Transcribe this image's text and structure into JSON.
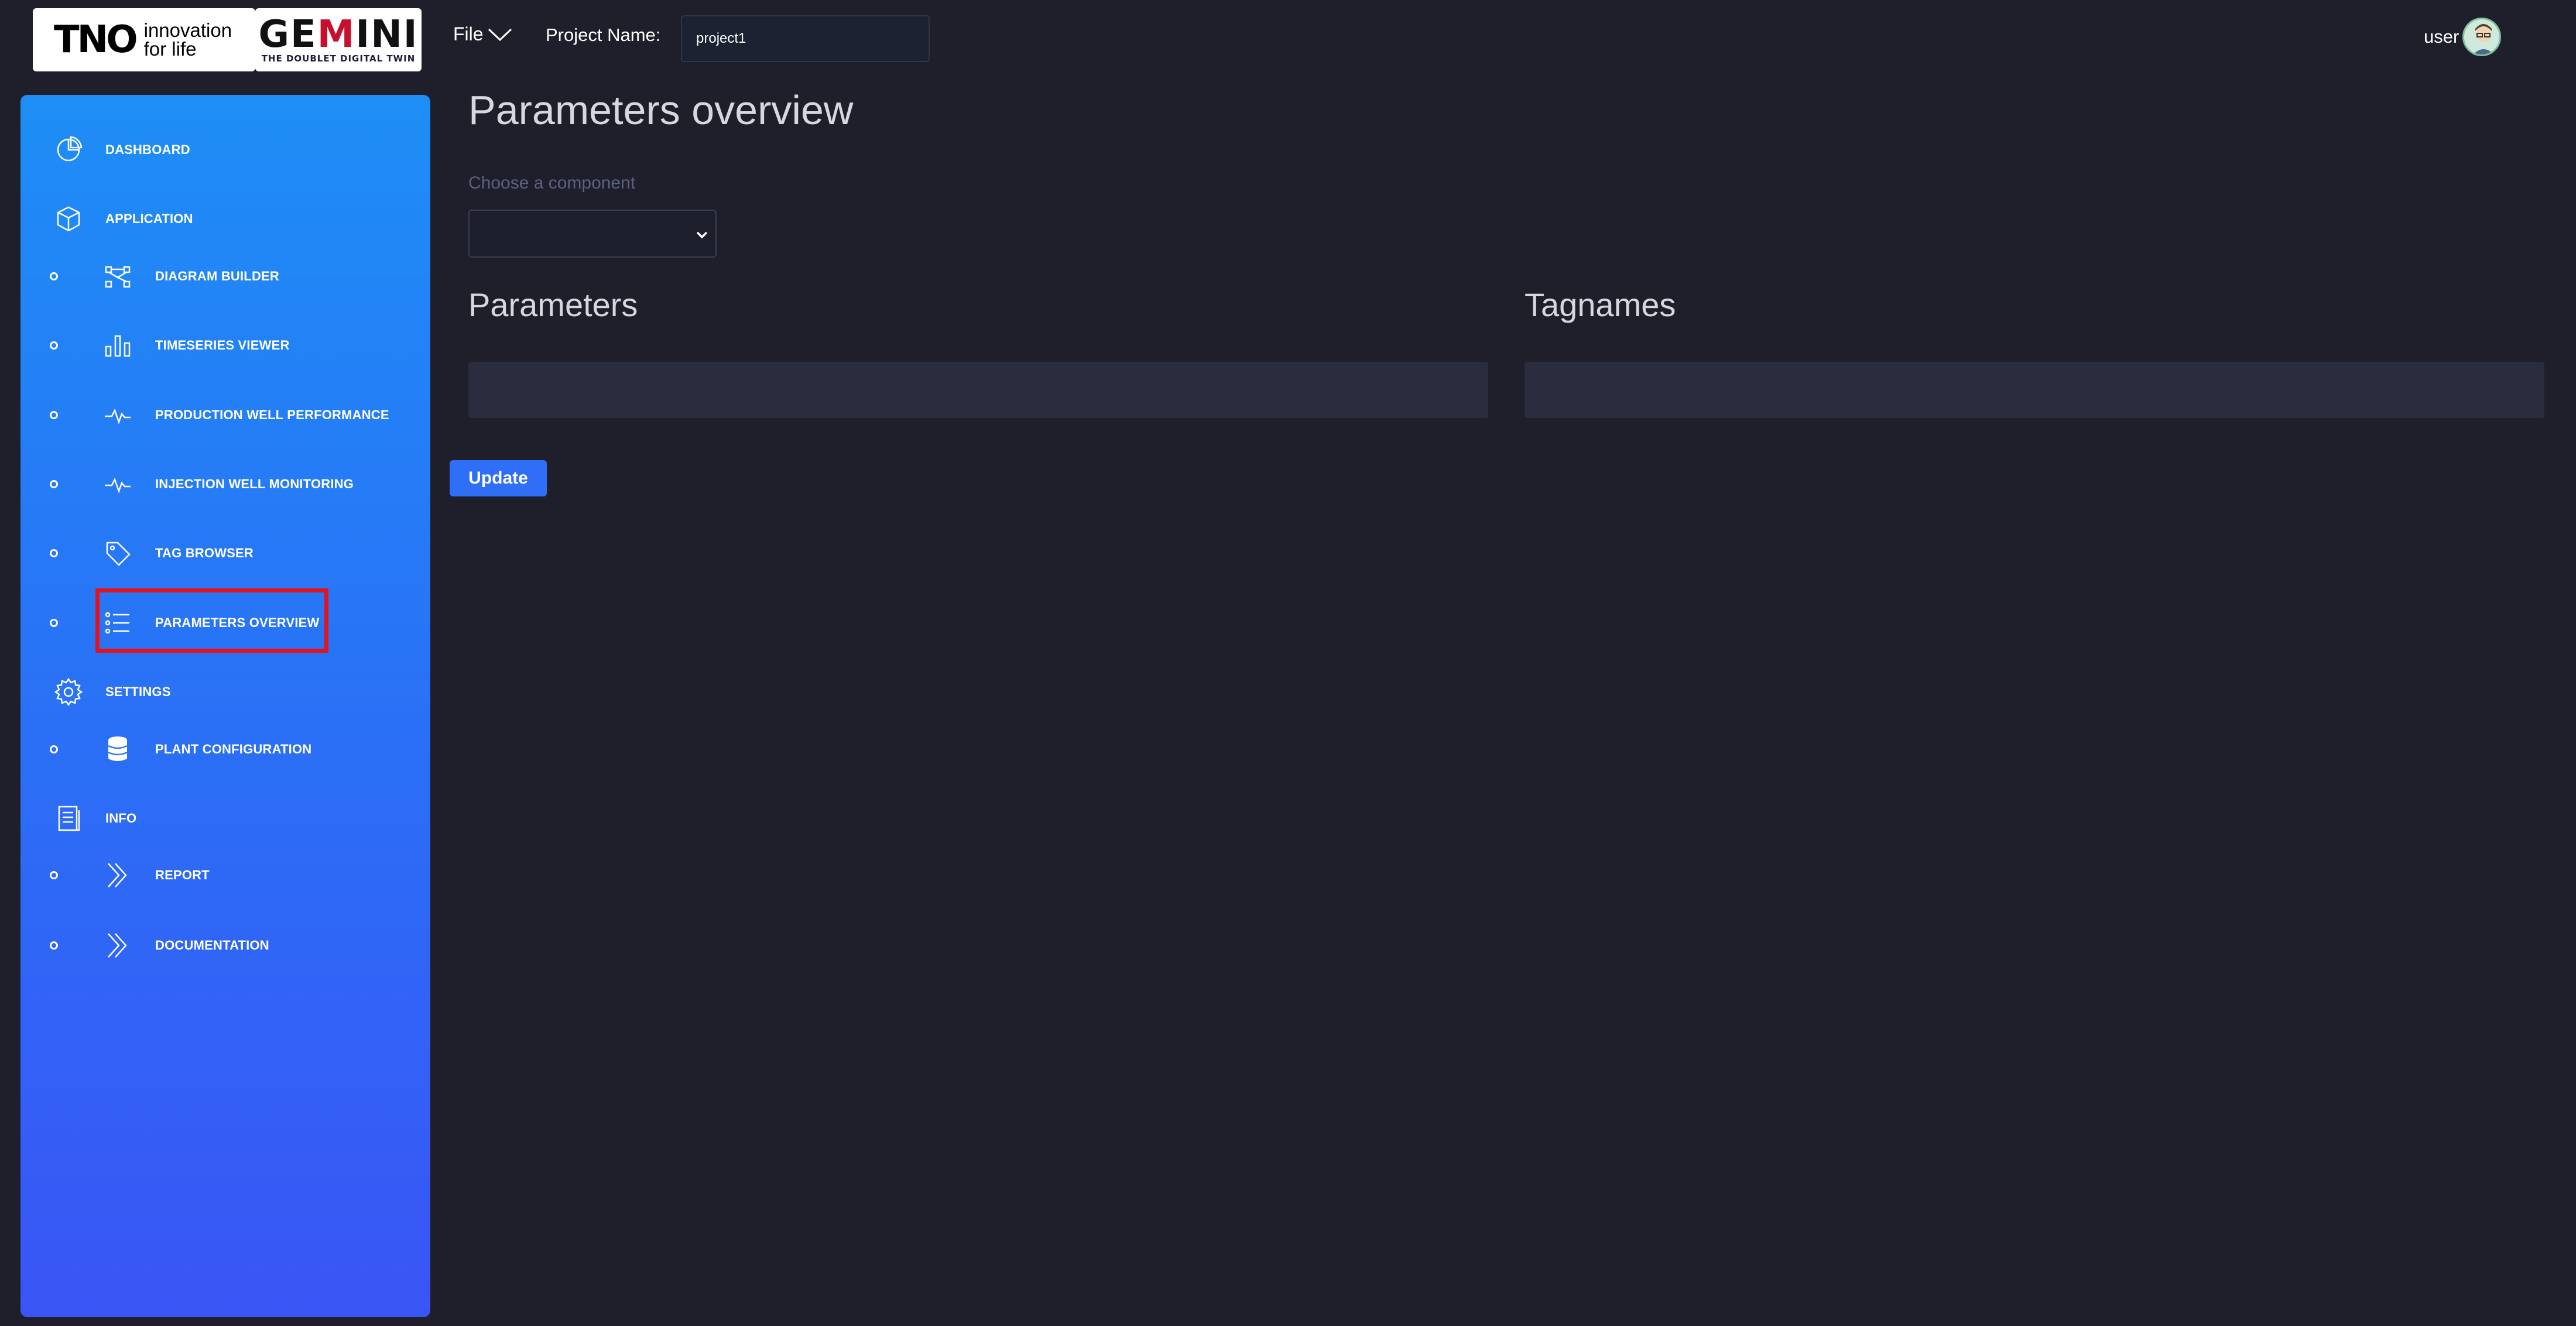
{
  "header": {
    "logo_tno": {
      "mark": "TNO",
      "tagline_1": "innovation",
      "tagline_2": "for life"
    },
    "logo_gemini": {
      "word_prefix": "GE",
      "word_m": "M",
      "word_suffix": "INI",
      "subtitle": "THE DOUBLET DIGITAL TWIN"
    },
    "file_menu_label": "File",
    "project_label": "Project Name:",
    "project_value": "project1",
    "user_label": "user"
  },
  "sidebar": {
    "items": [
      {
        "label": "DASHBOARD",
        "icon": "pie-chart-icon",
        "level": "top"
      },
      {
        "label": "APPLICATION",
        "icon": "cube-icon",
        "level": "top"
      },
      {
        "label": "DIAGRAM BUILDER",
        "icon": "diagram-icon",
        "level": "sub"
      },
      {
        "label": "TIMESERIES VIEWER",
        "icon": "bar-chart-icon",
        "level": "sub"
      },
      {
        "label": "PRODUCTION WELL PERFORMANCE",
        "icon": "pulse-icon",
        "level": "sub"
      },
      {
        "label": "INJECTION WELL MONITORING",
        "icon": "pulse-icon",
        "level": "sub"
      },
      {
        "label": "TAG BROWSER",
        "icon": "tag-icon",
        "level": "sub"
      },
      {
        "label": "PARAMETERS OVERVIEW",
        "icon": "list-icon",
        "level": "sub",
        "highlighted": true
      },
      {
        "label": "SETTINGS",
        "icon": "gear-icon",
        "level": "top"
      },
      {
        "label": "PLANT CONFIGURATION",
        "icon": "database-icon",
        "level": "sub"
      },
      {
        "label": "INFO",
        "icon": "book-icon",
        "level": "top"
      },
      {
        "label": "REPORT",
        "icon": "double-chevron-icon",
        "level": "sub"
      },
      {
        "label": "DOCUMENTATION",
        "icon": "double-chevron-icon",
        "level": "sub"
      }
    ]
  },
  "main": {
    "title": "Parameters overview",
    "component_label": "Choose a component",
    "component_value": "",
    "parameters_title": "Parameters",
    "tagnames_title": "Tagnames",
    "update_label": "Update"
  },
  "colors": {
    "background": "#1f1f2b",
    "sidebar_top": "#1e8ef6",
    "sidebar_bottom": "#3a55f5",
    "accent": "#2f6ef6",
    "highlight": "#e1141d"
  }
}
